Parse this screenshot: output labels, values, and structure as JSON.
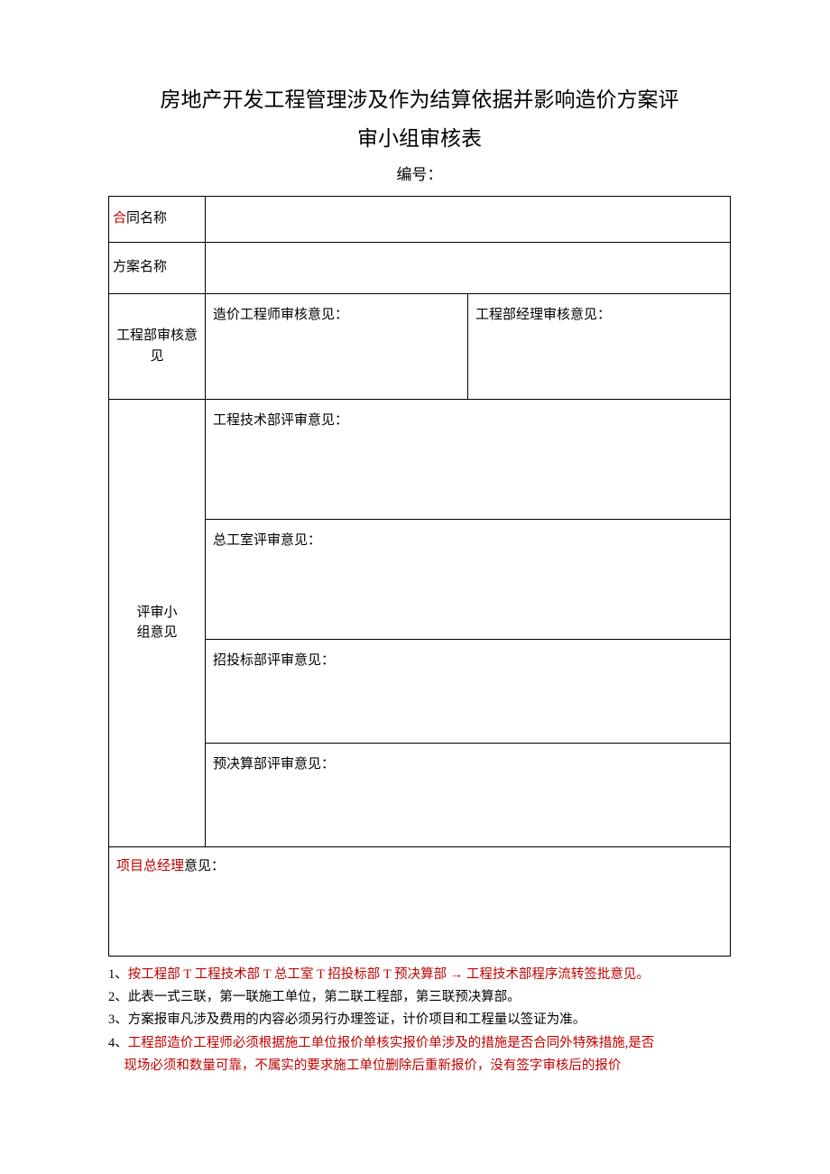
{
  "title_line1": "房地产开发工程管理涉及作为结算依据并影响造价方案评",
  "title_line2": "审小组审核表",
  "numbering_label": "编号：",
  "table": {
    "contract_name": {
      "label_red": "合",
      "label_rest": "同名称"
    },
    "plan_name_label": "方案名称",
    "eng_dept_label_l1": "工程部审核意",
    "eng_dept_label_l2": "见",
    "eng_cost_engineer": "造价工程师审核意见：",
    "eng_dept_manager": "工程部经理审核意见：",
    "review_group_label_l1": "评审小",
    "review_group_label_l2": "组意见",
    "op_tech": "工程技术部评审意见：",
    "op_chief": "总工室评审意见：",
    "op_bidding": "招投标部评审意见：",
    "op_budget": "预决算部评审意见：",
    "project_mgr_red": "项目总经理",
    "project_mgr_rest": "意见："
  },
  "notes": {
    "n1_prefix": "1、",
    "n1_red": "按工程部 T 工程技术部 T 总工室 T 招投标部 T 预决算部 → 工程技术部程序流转签批意见。",
    "n2": "2、此表一式三联，第一联施工单位，第二联工程部，第三联预决算部。",
    "n3": "3、方案报审凡涉及费用的内容必须另行办理签证，计价项目和工程量以签证为准。",
    "n4_prefix": "4、",
    "n4_red_a": "工程部造价工程师必须根据施工单位报价单核实报价单涉及的措施是否合同外特殊措施,是否",
    "n4_red_b": "现场必须和数量可靠，不属实的要求施工单位删除后重新报价，没有签字审核后的报价"
  }
}
